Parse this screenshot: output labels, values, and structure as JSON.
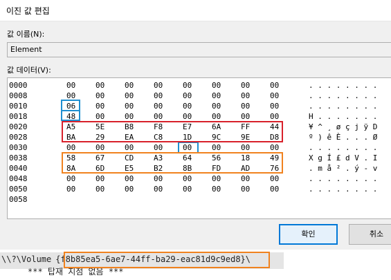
{
  "window": {
    "title": "이진 값 편집"
  },
  "value_name": {
    "label": "값 이름(N):",
    "value": "Element"
  },
  "value_data": {
    "label": "값 데이터(V):"
  },
  "hex_rows": [
    {
      "offset": "0000",
      "bytes": [
        "00",
        "00",
        "00",
        "00",
        "00",
        "00",
        "00",
        "00"
      ],
      "ascii": ". . . . . . . ."
    },
    {
      "offset": "0008",
      "bytes": [
        "00",
        "00",
        "00",
        "00",
        "00",
        "00",
        "00",
        "00"
      ],
      "ascii": ". . . . . . . ."
    },
    {
      "offset": "0010",
      "bytes": [
        "06",
        "00",
        "00",
        "00",
        "00",
        "00",
        "00",
        "00"
      ],
      "ascii": ". . . . . . . ."
    },
    {
      "offset": "0018",
      "bytes": [
        "48",
        "00",
        "00",
        "00",
        "00",
        "00",
        "00",
        "00"
      ],
      "ascii": "H . . . . . . ."
    },
    {
      "offset": "0020",
      "bytes": [
        "A5",
        "5E",
        "B8",
        "F8",
        "E7",
        "6A",
        "FF",
        "44"
      ],
      "ascii": "¥ ^ ¸ ø ç j ÿ D"
    },
    {
      "offset": "0028",
      "bytes": [
        "BA",
        "29",
        "EA",
        "C8",
        "1D",
        "9C",
        "9E",
        "D8"
      ],
      "ascii": "º ) ê È . . . Ø"
    },
    {
      "offset": "0030",
      "bytes": [
        "00",
        "00",
        "00",
        "00",
        "00",
        "00",
        "00",
        "00"
      ],
      "ascii": ". . . . . . . ."
    },
    {
      "offset": "0038",
      "bytes": [
        "58",
        "67",
        "CD",
        "A3",
        "64",
        "56",
        "18",
        "49"
      ],
      "ascii": "X g Í £ d V . I"
    },
    {
      "offset": "0040",
      "bytes": [
        "8A",
        "6D",
        "E5",
        "B2",
        "8B",
        "FD",
        "AD",
        "76"
      ],
      "ascii": ". m å ² . ý - v"
    },
    {
      "offset": "0048",
      "bytes": [
        "00",
        "00",
        "00",
        "00",
        "00",
        "00",
        "00",
        "00"
      ],
      "ascii": ". . . . . . . ."
    },
    {
      "offset": "0050",
      "bytes": [
        "00",
        "00",
        "00",
        "00",
        "00",
        "00",
        "00",
        "00"
      ],
      "ascii": ". . . . . . . ."
    },
    {
      "offset": "0058",
      "bytes": [],
      "ascii": ""
    }
  ],
  "buttons": {
    "ok": "확인",
    "cancel": "취소"
  },
  "console": {
    "prefix": "\\\\?\\Volume",
    "guid": "{f8b85ea5-6ae7-44ff-ba29-eac81d9c9ed8}",
    "suffix": "\\",
    "line2": "*** 탑재 지점 없음 ***"
  },
  "colors": {
    "blue_highlight": "#1e8fd0",
    "red_highlight": "#d8202a",
    "orange_highlight": "#f0821e",
    "ok_border": "#0078d7"
  }
}
